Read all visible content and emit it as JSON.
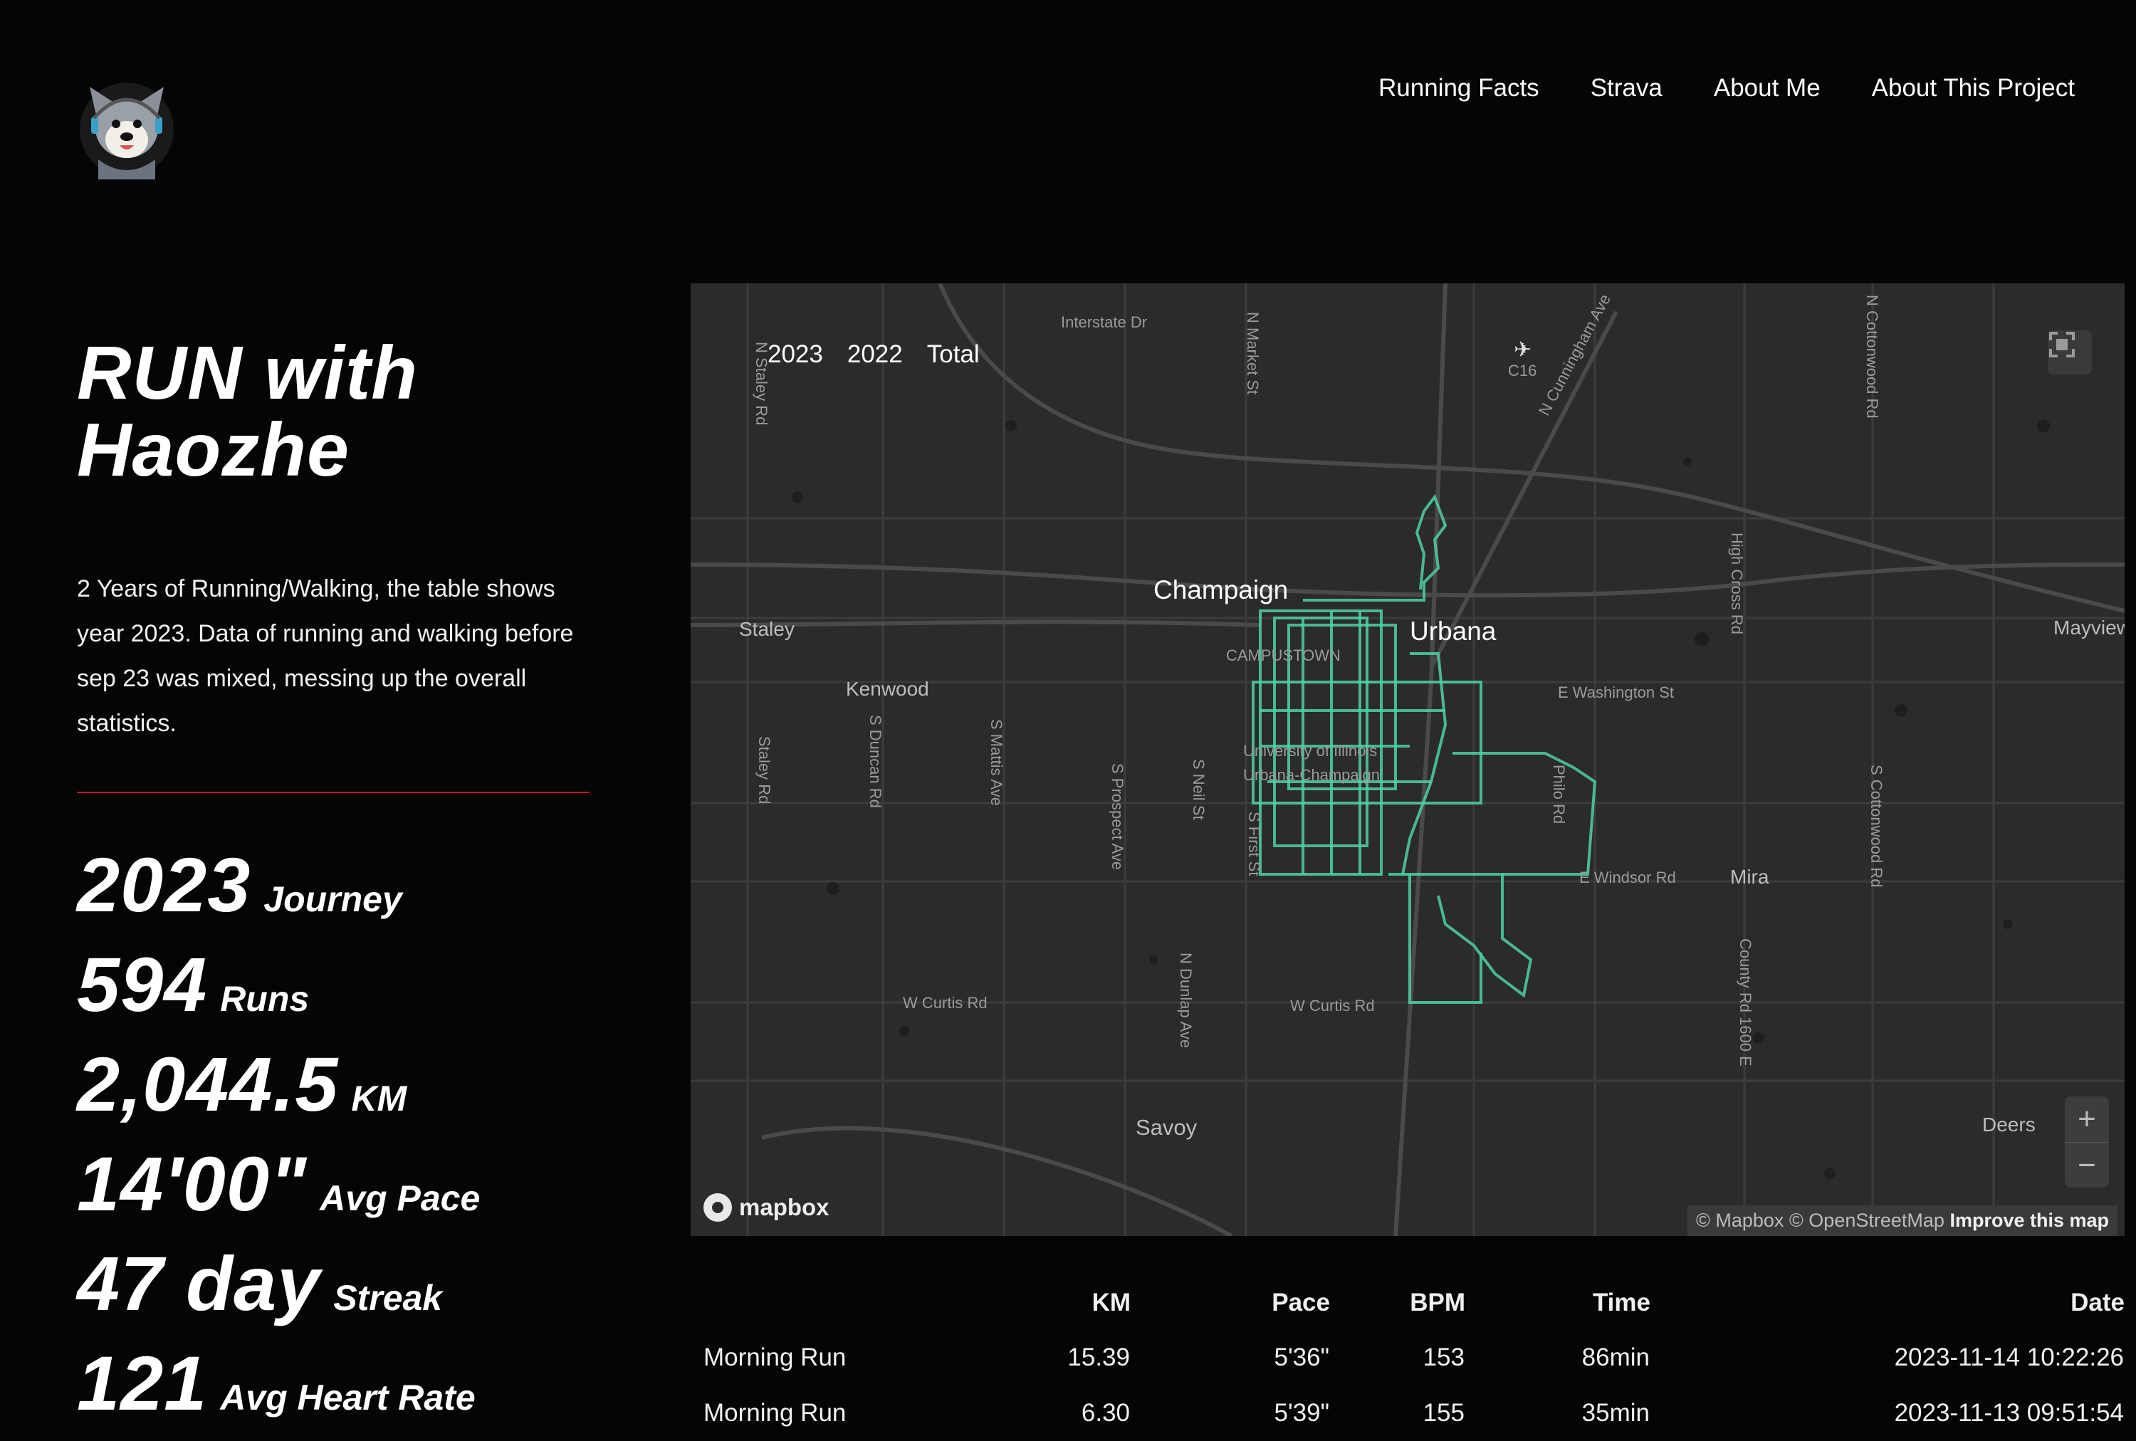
{
  "nav": {
    "items": [
      "Running Facts",
      "Strava",
      "About Me",
      "About This Project"
    ]
  },
  "site": {
    "title_line1": "RUN with",
    "title_line2": "Haozhe",
    "description": "2 Years of Running/Walking, the table shows year 2023. Data of running and walking before sep 23 was mixed, messing up the overall statistics."
  },
  "stats": [
    {
      "value": "2023",
      "label": "Journey"
    },
    {
      "value": "594",
      "label": "Runs"
    },
    {
      "value": "2,044.5",
      "label": "KM"
    },
    {
      "value": "14'00\"",
      "label": "Avg Pace"
    },
    {
      "value": "47 day",
      "label": "Streak"
    },
    {
      "value": "121",
      "label": "Avg Heart Rate"
    }
  ],
  "map": {
    "year_tabs": [
      "2023",
      "2022",
      "Total"
    ],
    "cities": [
      "Champaign",
      "Urbana"
    ],
    "towns": [
      "Staley",
      "Kenwood",
      "Savoy",
      "Mayview",
      "Mira",
      "Deers"
    ],
    "streets": [
      "Interstate Dr",
      "N Market St",
      "C16",
      "N Cunningham Ave",
      "N Cottonwood Rd",
      "N Staley Rd",
      "High Cross Rd",
      "E Washington St",
      "S Duncan Rd",
      "S Mattis Ave",
      "S Prospect Ave",
      "S Neil St",
      "S First St",
      "Philo Rd",
      "E Windsor Rd",
      "W Curtis Rd",
      "W Curtis Rd",
      "N Dunlap Ave",
      "County Rd 1600 E",
      "S Cottonwood Rd",
      "Staley Rd",
      "CAMPUSTOWN",
      "University of Illinois",
      "Urbana-Champaign"
    ],
    "logo": "mapbox",
    "attribution": "© Mapbox © OpenStreetMap",
    "improve": "Improve this map",
    "route_color": "#4fd1a5",
    "background_color": "#2b2b2b"
  },
  "table": {
    "headers": [
      "",
      "KM",
      "Pace",
      "BPM",
      "Time",
      "Date"
    ],
    "rows": [
      {
        "name": "Morning Run",
        "km": "15.39",
        "pace": "5'36\"",
        "bpm": "153",
        "time": "86min",
        "date": "2023-11-14 10:22:26"
      },
      {
        "name": "Morning Run",
        "km": "6.30",
        "pace": "5'39\"",
        "bpm": "155",
        "time": "35min",
        "date": "2023-11-13 09:51:54"
      }
    ]
  }
}
